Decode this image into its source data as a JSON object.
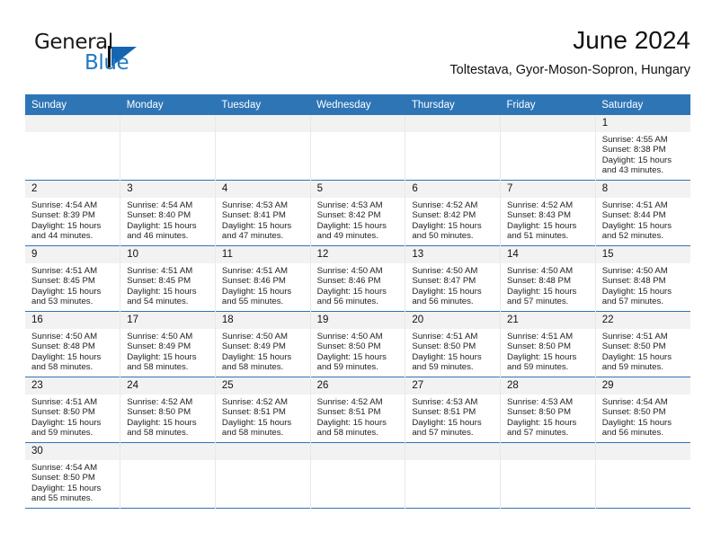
{
  "brand": {
    "name_top": "General",
    "name_bottom": "Blue",
    "mark": "triangle-flag-icon",
    "color_blue": "#2278c4",
    "color_black": "#1a1a1a"
  },
  "header": {
    "title": "June 2024",
    "subtitle": "Toltestava, Gyor-Moson-Sopron, Hungary"
  },
  "theme": {
    "header_blue": "#2e75b6",
    "daynum_bg": "#f2f2f2",
    "row_rule": "#2e75b6"
  },
  "labels": {
    "sunrise_prefix": "Sunrise:",
    "sunset_prefix": "Sunset:",
    "daylight_prefix": "Daylight:"
  },
  "weekday_headers": [
    "Sunday",
    "Monday",
    "Tuesday",
    "Wednesday",
    "Thursday",
    "Friday",
    "Saturday"
  ],
  "weeks": [
    [
      {
        "day": ""
      },
      {
        "day": ""
      },
      {
        "day": ""
      },
      {
        "day": ""
      },
      {
        "day": ""
      },
      {
        "day": ""
      },
      {
        "day": "1",
        "sunrise": "Sunrise: 4:55 AM",
        "sunset": "Sunset: 8:38 PM",
        "daylight_a": "Daylight: 15 hours",
        "daylight_b": "and 43 minutes."
      }
    ],
    [
      {
        "day": "2",
        "sunrise": "Sunrise: 4:54 AM",
        "sunset": "Sunset: 8:39 PM",
        "daylight_a": "Daylight: 15 hours",
        "daylight_b": "and 44 minutes."
      },
      {
        "day": "3",
        "sunrise": "Sunrise: 4:54 AM",
        "sunset": "Sunset: 8:40 PM",
        "daylight_a": "Daylight: 15 hours",
        "daylight_b": "and 46 minutes."
      },
      {
        "day": "4",
        "sunrise": "Sunrise: 4:53 AM",
        "sunset": "Sunset: 8:41 PM",
        "daylight_a": "Daylight: 15 hours",
        "daylight_b": "and 47 minutes."
      },
      {
        "day": "5",
        "sunrise": "Sunrise: 4:53 AM",
        "sunset": "Sunset: 8:42 PM",
        "daylight_a": "Daylight: 15 hours",
        "daylight_b": "and 49 minutes."
      },
      {
        "day": "6",
        "sunrise": "Sunrise: 4:52 AM",
        "sunset": "Sunset: 8:42 PM",
        "daylight_a": "Daylight: 15 hours",
        "daylight_b": "and 50 minutes."
      },
      {
        "day": "7",
        "sunrise": "Sunrise: 4:52 AM",
        "sunset": "Sunset: 8:43 PM",
        "daylight_a": "Daylight: 15 hours",
        "daylight_b": "and 51 minutes."
      },
      {
        "day": "8",
        "sunrise": "Sunrise: 4:51 AM",
        "sunset": "Sunset: 8:44 PM",
        "daylight_a": "Daylight: 15 hours",
        "daylight_b": "and 52 minutes."
      }
    ],
    [
      {
        "day": "9",
        "sunrise": "Sunrise: 4:51 AM",
        "sunset": "Sunset: 8:45 PM",
        "daylight_a": "Daylight: 15 hours",
        "daylight_b": "and 53 minutes."
      },
      {
        "day": "10",
        "sunrise": "Sunrise: 4:51 AM",
        "sunset": "Sunset: 8:45 PM",
        "daylight_a": "Daylight: 15 hours",
        "daylight_b": "and 54 minutes."
      },
      {
        "day": "11",
        "sunrise": "Sunrise: 4:51 AM",
        "sunset": "Sunset: 8:46 PM",
        "daylight_a": "Daylight: 15 hours",
        "daylight_b": "and 55 minutes."
      },
      {
        "day": "12",
        "sunrise": "Sunrise: 4:50 AM",
        "sunset": "Sunset: 8:46 PM",
        "daylight_a": "Daylight: 15 hours",
        "daylight_b": "and 56 minutes."
      },
      {
        "day": "13",
        "sunrise": "Sunrise: 4:50 AM",
        "sunset": "Sunset: 8:47 PM",
        "daylight_a": "Daylight: 15 hours",
        "daylight_b": "and 56 minutes."
      },
      {
        "day": "14",
        "sunrise": "Sunrise: 4:50 AM",
        "sunset": "Sunset: 8:48 PM",
        "daylight_a": "Daylight: 15 hours",
        "daylight_b": "and 57 minutes."
      },
      {
        "day": "15",
        "sunrise": "Sunrise: 4:50 AM",
        "sunset": "Sunset: 8:48 PM",
        "daylight_a": "Daylight: 15 hours",
        "daylight_b": "and 57 minutes."
      }
    ],
    [
      {
        "day": "16",
        "sunrise": "Sunrise: 4:50 AM",
        "sunset": "Sunset: 8:48 PM",
        "daylight_a": "Daylight: 15 hours",
        "daylight_b": "and 58 minutes."
      },
      {
        "day": "17",
        "sunrise": "Sunrise: 4:50 AM",
        "sunset": "Sunset: 8:49 PM",
        "daylight_a": "Daylight: 15 hours",
        "daylight_b": "and 58 minutes."
      },
      {
        "day": "18",
        "sunrise": "Sunrise: 4:50 AM",
        "sunset": "Sunset: 8:49 PM",
        "daylight_a": "Daylight: 15 hours",
        "daylight_b": "and 58 minutes."
      },
      {
        "day": "19",
        "sunrise": "Sunrise: 4:50 AM",
        "sunset": "Sunset: 8:50 PM",
        "daylight_a": "Daylight: 15 hours",
        "daylight_b": "and 59 minutes."
      },
      {
        "day": "20",
        "sunrise": "Sunrise: 4:51 AM",
        "sunset": "Sunset: 8:50 PM",
        "daylight_a": "Daylight: 15 hours",
        "daylight_b": "and 59 minutes."
      },
      {
        "day": "21",
        "sunrise": "Sunrise: 4:51 AM",
        "sunset": "Sunset: 8:50 PM",
        "daylight_a": "Daylight: 15 hours",
        "daylight_b": "and 59 minutes."
      },
      {
        "day": "22",
        "sunrise": "Sunrise: 4:51 AM",
        "sunset": "Sunset: 8:50 PM",
        "daylight_a": "Daylight: 15 hours",
        "daylight_b": "and 59 minutes."
      }
    ],
    [
      {
        "day": "23",
        "sunrise": "Sunrise: 4:51 AM",
        "sunset": "Sunset: 8:50 PM",
        "daylight_a": "Daylight: 15 hours",
        "daylight_b": "and 59 minutes."
      },
      {
        "day": "24",
        "sunrise": "Sunrise: 4:52 AM",
        "sunset": "Sunset: 8:50 PM",
        "daylight_a": "Daylight: 15 hours",
        "daylight_b": "and 58 minutes."
      },
      {
        "day": "25",
        "sunrise": "Sunrise: 4:52 AM",
        "sunset": "Sunset: 8:51 PM",
        "daylight_a": "Daylight: 15 hours",
        "daylight_b": "and 58 minutes."
      },
      {
        "day": "26",
        "sunrise": "Sunrise: 4:52 AM",
        "sunset": "Sunset: 8:51 PM",
        "daylight_a": "Daylight: 15 hours",
        "daylight_b": "and 58 minutes."
      },
      {
        "day": "27",
        "sunrise": "Sunrise: 4:53 AM",
        "sunset": "Sunset: 8:51 PM",
        "daylight_a": "Daylight: 15 hours",
        "daylight_b": "and 57 minutes."
      },
      {
        "day": "28",
        "sunrise": "Sunrise: 4:53 AM",
        "sunset": "Sunset: 8:50 PM",
        "daylight_a": "Daylight: 15 hours",
        "daylight_b": "and 57 minutes."
      },
      {
        "day": "29",
        "sunrise": "Sunrise: 4:54 AM",
        "sunset": "Sunset: 8:50 PM",
        "daylight_a": "Daylight: 15 hours",
        "daylight_b": "and 56 minutes."
      }
    ],
    [
      {
        "day": "30",
        "sunrise": "Sunrise: 4:54 AM",
        "sunset": "Sunset: 8:50 PM",
        "daylight_a": "Daylight: 15 hours",
        "daylight_b": "and 55 minutes."
      },
      {
        "day": ""
      },
      {
        "day": ""
      },
      {
        "day": ""
      },
      {
        "day": ""
      },
      {
        "day": ""
      },
      {
        "day": ""
      }
    ]
  ]
}
